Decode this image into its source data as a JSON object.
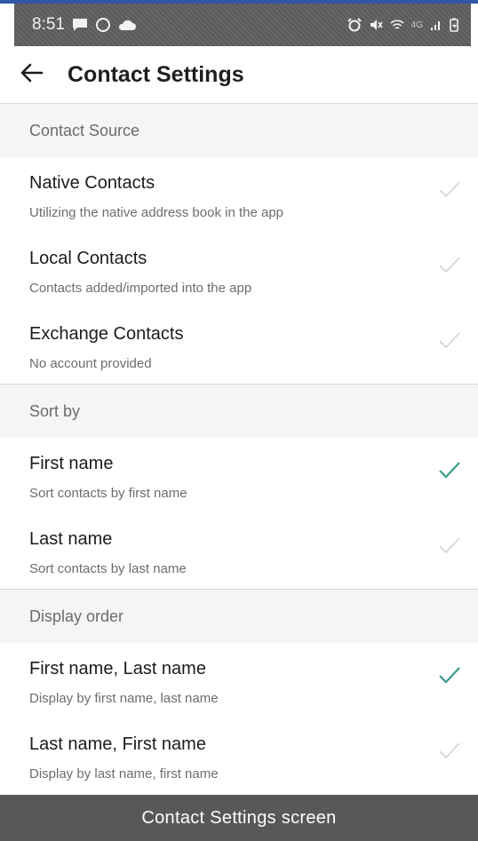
{
  "status_bar": {
    "time": "8:51",
    "left_icons": [
      "message-icon",
      "sync-circle-icon",
      "cloud-icon"
    ],
    "right_icons": [
      "alarm-icon",
      "mute-icon",
      "wifi-icon",
      "signal-icon",
      "battery-icon"
    ],
    "network": "4G"
  },
  "header": {
    "back_icon": "arrow-left-icon",
    "title": "Contact Settings"
  },
  "sections": [
    {
      "label": "Contact Source",
      "options": [
        {
          "title": "Native Contacts",
          "subtitle": "Utilizing the native address book in the app",
          "checked": false
        },
        {
          "title": "Local Contacts",
          "subtitle": "Contacts added/imported into the app",
          "checked": false
        },
        {
          "title": "Exchange Contacts",
          "subtitle": "No account provided",
          "checked": false
        }
      ]
    },
    {
      "label": "Sort by",
      "options": [
        {
          "title": "First name",
          "subtitle": "Sort contacts by first name",
          "checked": true
        },
        {
          "title": "Last name",
          "subtitle": "Sort contacts by last name",
          "checked": false
        }
      ]
    },
    {
      "label": "Display order",
      "options": [
        {
          "title": "First name, Last name",
          "subtitle": "Display by first name, last name",
          "checked": true
        },
        {
          "title": "Last name, First name",
          "subtitle": "Display by last name, first name",
          "checked": false
        }
      ]
    }
  ],
  "colors": {
    "check_active": "#3a9c8c",
    "check_inactive": "#d2d2d2",
    "section_bg": "#f5f5f5",
    "status_bar": "#5a5a5a",
    "bottom_bar": "#585858"
  },
  "caption": "Contact Settings screen"
}
